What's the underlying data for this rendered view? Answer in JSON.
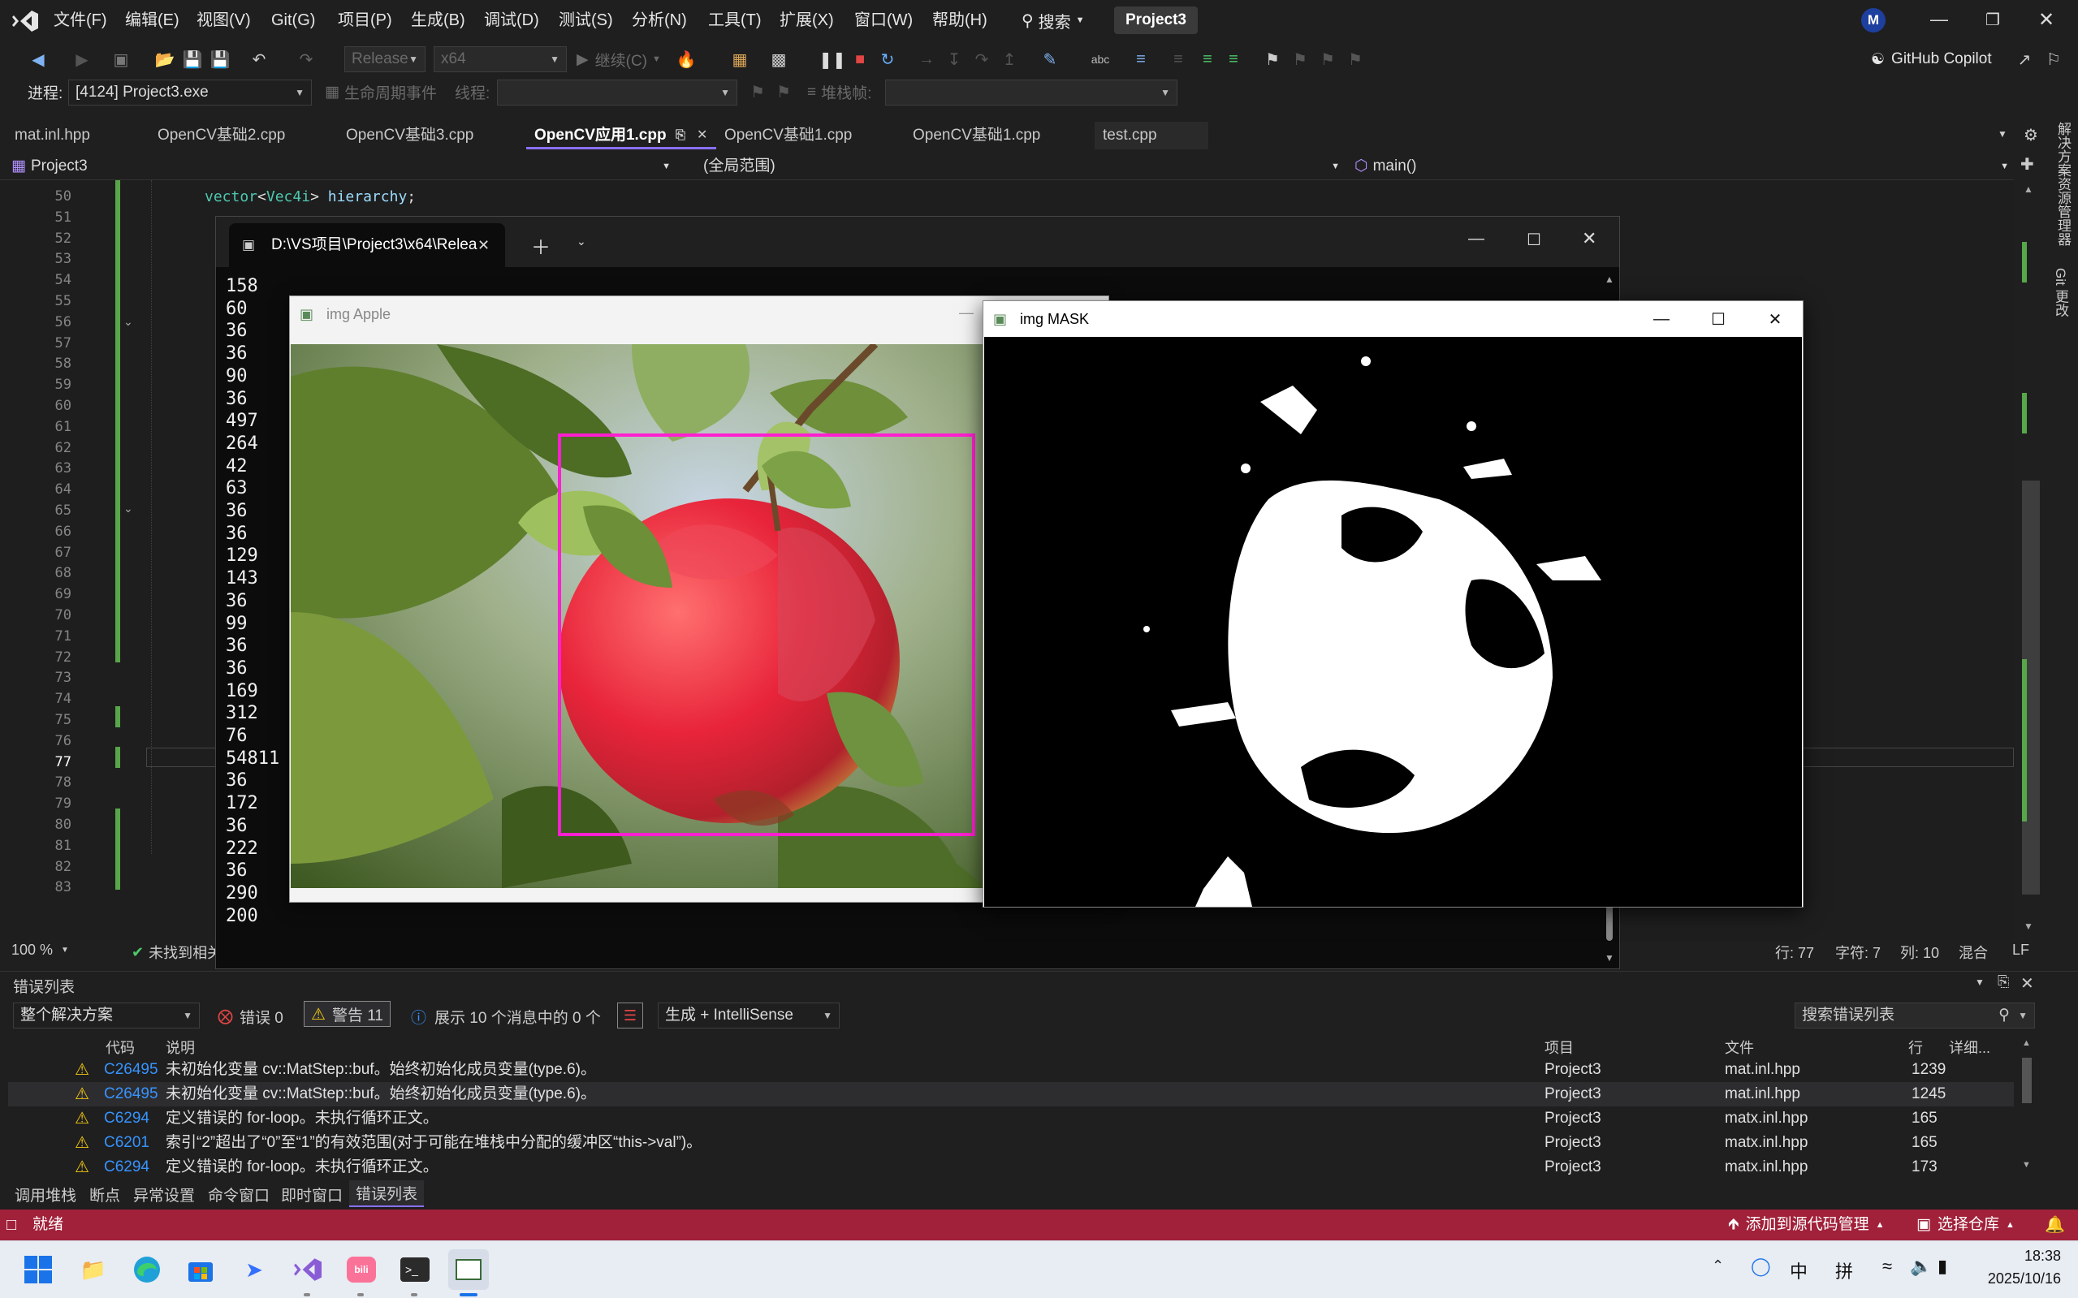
{
  "menubar": {
    "items": [
      "文件(F)",
      "编辑(E)",
      "视图(V)",
      "Git(G)",
      "项目(P)",
      "生成(B)",
      "调试(D)",
      "测试(S)",
      "分析(N)",
      "工具(T)",
      "扩展(X)",
      "窗口(W)",
      "帮助(H)"
    ],
    "search": "搜索",
    "project_badge": "Project3",
    "avatar": "M"
  },
  "toolbar": {
    "config": "Release",
    "platform": "x64",
    "continue": "继续(C)",
    "copilot": "GitHub Copilot"
  },
  "debugbar": {
    "process_label": "进程:",
    "process_value": "[4124] Project3.exe",
    "lifecycle": "生命周期事件",
    "thread_label": "线程:",
    "stackframe_label": "堆栈帧:"
  },
  "tabs": [
    "mat.inl.hpp",
    "OpenCV基础2.cpp",
    "OpenCV基础3.cpp",
    "OpenCV应用1.cpp",
    "OpenCV基础1.cpp",
    "OpenCV基础1.cpp",
    "test.cpp"
  ],
  "navbar": {
    "project": "Project3",
    "scope": "(全局范围)",
    "member": "main()"
  },
  "editor": {
    "line_numbers": [
      "50",
      "51",
      "52",
      "53",
      "54",
      "55",
      "56",
      "57",
      "58",
      "59",
      "60",
      "61",
      "62",
      "63",
      "64",
      "65",
      "66",
      "67",
      "68",
      "69",
      "70",
      "71",
      "72",
      "73",
      "74",
      "75",
      "76",
      "77",
      "78",
      "79",
      "80",
      "81",
      "82",
      "83"
    ],
    "code_line_50": "vector<Vec4i> hierarchy;",
    "zoom": "100 %",
    "issues": "未找到相关",
    "cursor_line": "行: 77",
    "cursor_char": "字符: 7",
    "cursor_col": "列: 10",
    "mixed": "混合",
    "eol": "LF"
  },
  "console": {
    "tab_title": "D:\\VS项目\\Project3\\x64\\Relea",
    "output": [
      "158",
      "60",
      "36",
      "36",
      "90",
      "36",
      "497",
      "264",
      "42",
      "63",
      "36",
      "36",
      "129",
      "143",
      "36",
      "99",
      "36",
      "36",
      "169",
      "312",
      "76",
      "54811",
      "36",
      "172",
      "36",
      "222",
      "36",
      "290",
      "200"
    ]
  },
  "apple_window": {
    "title": "img Apple"
  },
  "mask_window": {
    "title": "img MASK"
  },
  "error_list": {
    "title": "错误列表",
    "scope": "整个解决方案",
    "errors": "错误 0",
    "warnings": "警告 11",
    "messages": "展示 10 个消息中的 0 个",
    "build": "生成 + IntelliSense",
    "search_placeholder": "搜索错误列表",
    "columns": [
      "代码",
      "说明",
      "项目",
      "文件",
      "行",
      "详细..."
    ],
    "rows": [
      {
        "code": "C26495",
        "desc": "未初始化变量 cv::MatStep::buf。始终初始化成员变量(type.6)。",
        "project": "Project3",
        "file": "mat.inl.hpp",
        "line": "1239"
      },
      {
        "code": "C26495",
        "desc": "未初始化变量 cv::MatStep::buf。始终初始化成员变量(type.6)。",
        "project": "Project3",
        "file": "mat.inl.hpp",
        "line": "1245"
      },
      {
        "code": "C6294",
        "desc": "定义错误的 for-loop。未执行循环正文。",
        "project": "Project3",
        "file": "matx.inl.hpp",
        "line": "165"
      },
      {
        "code": "C6201",
        "desc": "索引“2”超出了“0”至“1”的有效范围(对于可能在堆栈中分配的缓冲区“this->val”)。",
        "project": "Project3",
        "file": "matx.inl.hpp",
        "line": "165"
      },
      {
        "code": "C6294",
        "desc": "定义错误的 for-loop。未执行循环正文。",
        "project": "Project3",
        "file": "matx.inl.hpp",
        "line": "173"
      }
    ]
  },
  "bottom_tabs": [
    "调用堆栈",
    "断点",
    "异常设置",
    "命令窗口",
    "即时窗口",
    "错误列表"
  ],
  "statusbar": {
    "ready": "就绪",
    "add_source": "添加到源代码管理",
    "select_repo": "选择仓库"
  },
  "right_rail": {
    "solution_explorer": "解决方案资源管理器",
    "git_changes": "Git 更改"
  },
  "taskbar": {
    "time": "18:38",
    "date": "2025/10/16",
    "ime1": "中",
    "ime2": "拼"
  }
}
